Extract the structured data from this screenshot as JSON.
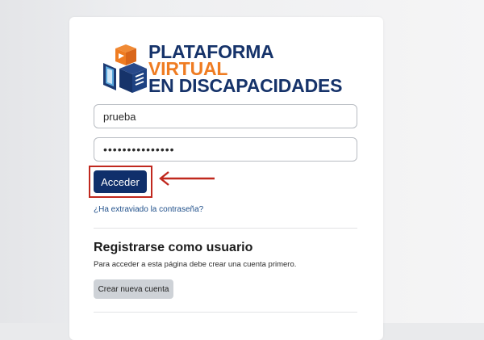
{
  "logo": {
    "line1": "PLATAFORMA",
    "line2": "VIRTUAL",
    "line3": "EN DISCAPACIDADES",
    "color_primary": "#16336a",
    "color_accent": "#ef7c22"
  },
  "login": {
    "username_value": "prueba",
    "password_value": "•••••••••••••••",
    "submit_label": "Acceder",
    "forgot_link": "¿Ha extraviado la contraseña?"
  },
  "register": {
    "title": "Registrarse como usuario",
    "text": "Para acceder a esta página debe crear una cuenta primero.",
    "button_label": "Crear nueva cuenta"
  },
  "colors": {
    "primary_button": "#0f2f6b",
    "highlight": "#c0281e",
    "link": "#1f4f8a"
  }
}
